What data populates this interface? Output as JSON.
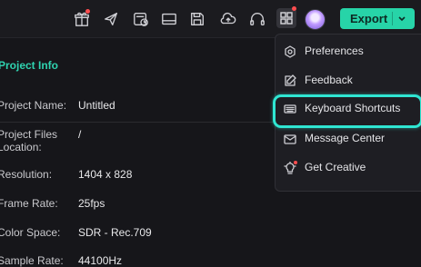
{
  "toolbar": {
    "icons": [
      "gift-icon",
      "send-icon",
      "calendar-clock-icon",
      "layout-icon",
      "save-icon",
      "cloud-upload-icon",
      "headphones-icon",
      "grid-icon",
      "avatar"
    ],
    "export_label": "Export"
  },
  "project_info": {
    "title": "Project Info",
    "rows": [
      {
        "label": "Project Name:",
        "value": "Untitled"
      },
      {
        "label": "Project Files Location:",
        "value": "/"
      },
      {
        "label": "Resolution:",
        "value": "1404 x 828"
      },
      {
        "label": "Frame Rate:",
        "value": "25fps"
      },
      {
        "label": "Color Space:",
        "value": "SDR - Rec.709"
      },
      {
        "label": "Sample Rate:",
        "value": "44100Hz"
      }
    ]
  },
  "menu": {
    "items": [
      {
        "label": "Preferences",
        "icon": "gear-icon"
      },
      {
        "label": "Feedback",
        "icon": "feedback-icon"
      },
      {
        "label": "Keyboard Shortcuts",
        "icon": "keyboard-icon",
        "highlighted": true
      },
      {
        "label": "Message Center",
        "icon": "mail-icon"
      },
      {
        "label": "Get Creative",
        "icon": "lightbulb-icon"
      }
    ]
  },
  "colors": {
    "accent": "#27d4a8",
    "highlight": "#2fe6d2",
    "title": "#2fd3b0",
    "notification": "#ff4d4f"
  }
}
